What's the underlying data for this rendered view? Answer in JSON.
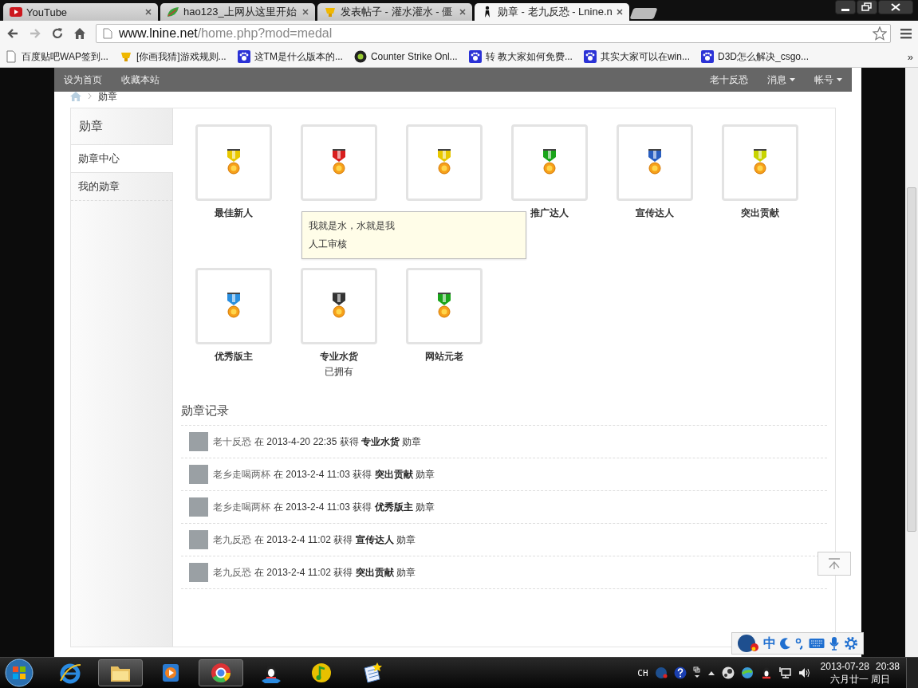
{
  "browser": {
    "tabs": [
      {
        "title": "YouTube",
        "kind": "youtube",
        "selected": false
      },
      {
        "title": "hao123_上网从这里开始",
        "kind": "hao",
        "selected": false
      },
      {
        "title": "发表帖子 - 灌水灌水 - 僵",
        "kind": "cup",
        "selected": false
      },
      {
        "title": "勋章 - 老九反恐 - Lnine.n",
        "kind": "cs",
        "selected": true
      }
    ],
    "address": {
      "host": "www.lnine.net",
      "path": "/home.php?mod=medal"
    },
    "bookmarks": [
      {
        "title": "百度贴吧WAP签到...",
        "kind": "page"
      },
      {
        "title": "[你画我猜]游戏规则...",
        "kind": "cup"
      },
      {
        "title": "这TM是什么版本的...",
        "kind": "paw"
      },
      {
        "title": "Counter Strike Onl...",
        "kind": "disc"
      },
      {
        "title": "转 教大家如何免费...",
        "kind": "paw"
      },
      {
        "title": "其实大家可以在win...",
        "kind": "paw"
      },
      {
        "title": "D3D怎么解决_csgo...",
        "kind": "paw"
      }
    ],
    "more": "»"
  },
  "site": {
    "nav_left": [
      "设为首页",
      "收藏本站"
    ],
    "nav_right": [
      {
        "label": "老十反恐",
        "dropdown": false
      },
      {
        "label": "消息",
        "dropdown": true
      },
      {
        "label": "帐号",
        "dropdown": true
      }
    ],
    "breadcrumb": "勋章"
  },
  "sidebar": {
    "title": "勋章",
    "items": [
      {
        "label": "勋章中心",
        "selected": true
      },
      {
        "label": "我的勋章",
        "selected": false
      }
    ]
  },
  "medals": [
    {
      "name": "最佳新人",
      "color": "#e8c800"
    },
    {
      "color": "#d81e1e"
    },
    {
      "color": "#e8c800"
    },
    {
      "name": "推广达人",
      "color": "#1aa51a"
    },
    {
      "name": "宣传达人",
      "color": "#2a5fc0"
    },
    {
      "name": "突出贡献",
      "color": "#c8d400"
    },
    {
      "name": "优秀版主",
      "color": "#2a8fe0"
    },
    {
      "name": "专业水货",
      "note": "已拥有",
      "color": "#333333"
    },
    {
      "name": "网站元老",
      "color": "#1aa51a"
    }
  ],
  "tooltip": {
    "lines": [
      "我就是水，水就是我",
      "人工审核"
    ]
  },
  "records": {
    "title": "勋章记录",
    "rows": [
      {
        "user": "老十反恐",
        "text": "在 2013-4-20 22:35 获得 **专业水货** 勋章"
      },
      {
        "user": "老乡走喝两杯",
        "text": "在 2013-2-4 11:03 获得 **突出贡献** 勋章"
      },
      {
        "user": "老乡走喝两杯",
        "text": "在 2013-2-4 11:03 获得 **优秀版主** 勋章"
      },
      {
        "user": "老九反恐",
        "text": "在 2013-2-4 11:02 获得 **宣传达人** 勋章"
      },
      {
        "user": "老九反恐",
        "text": "在 2013-2-4 11:02 获得 **突出贡献** 勋章"
      }
    ]
  },
  "ime": {
    "mode": "中"
  },
  "taskbar": {
    "apps": [
      {
        "kind": "ie",
        "active": false
      },
      {
        "kind": "folder",
        "active": true
      },
      {
        "kind": "media",
        "active": false
      },
      {
        "kind": "chrome",
        "active": true
      },
      {
        "kind": "penguin",
        "active": false
      },
      {
        "kind": "music",
        "active": false
      },
      {
        "kind": "notes",
        "active": false
      }
    ],
    "lang": "CH",
    "time": "20:38",
    "date": "2013-07-28",
    "lunar": "六月廿一 周日"
  }
}
